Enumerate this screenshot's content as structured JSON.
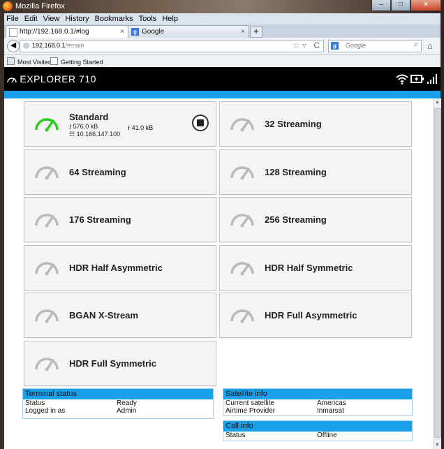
{
  "window": {
    "title": "Mozilla Firefox",
    "controls": [
      "–",
      "□",
      "×"
    ]
  },
  "menu": [
    "File",
    "Edit",
    "View",
    "History",
    "Bookmarks",
    "Tools",
    "Help"
  ],
  "tabs": [
    {
      "label": "http://192.168.0.1/#log",
      "close": "×"
    },
    {
      "label": "Google",
      "close": "×"
    }
  ],
  "newtab": "+",
  "nav": {
    "back": "◀",
    "url_host": "192.168.0.1",
    "url_path": "/#main",
    "star": "☆ ▿",
    "reload": "C",
    "search_engine": "g",
    "search_placeholder": "Google",
    "search_icon": "🔍",
    "home": "⌂"
  },
  "bookmarks": [
    "Most Visited",
    "Getting Started"
  ],
  "app": {
    "brand": "EXPLORER 710"
  },
  "tiles": [
    {
      "name": "Standard",
      "active": true,
      "download": "576.0 kB",
      "upload": "41.0 kB",
      "ip": "10.166.147.100"
    },
    {
      "name": "32 Streaming"
    },
    {
      "name": "64 Streaming"
    },
    {
      "name": "128 Streaming"
    },
    {
      "name": "176 Streaming"
    },
    {
      "name": "256 Streaming"
    },
    {
      "name": "HDR Half Asymmetric"
    },
    {
      "name": "HDR Half Symmetric"
    },
    {
      "name": "BGAN X-Stream"
    },
    {
      "name": "HDR Full Asymmetric"
    },
    {
      "name": "HDR Full Symmetric"
    }
  ],
  "terminal_status": {
    "title": "Terminal status",
    "rows": [
      {
        "label": "Status",
        "value": "Ready"
      },
      {
        "label": "Logged in as",
        "value": "Admin"
      }
    ]
  },
  "satellite_info": {
    "title": "Satellite info",
    "rows": [
      {
        "label": "Current satellite",
        "value": "Americas"
      },
      {
        "label": "Airtime Provider",
        "value": "Inmarsat"
      }
    ]
  },
  "call_info": {
    "title": "Call info",
    "rows": [
      {
        "label": "Status",
        "value": "Offline"
      }
    ]
  },
  "colors": {
    "accent": "#1aa0e8",
    "active_gauge": "#2ecc1f",
    "inactive_gauge": "#b9b9b9"
  }
}
